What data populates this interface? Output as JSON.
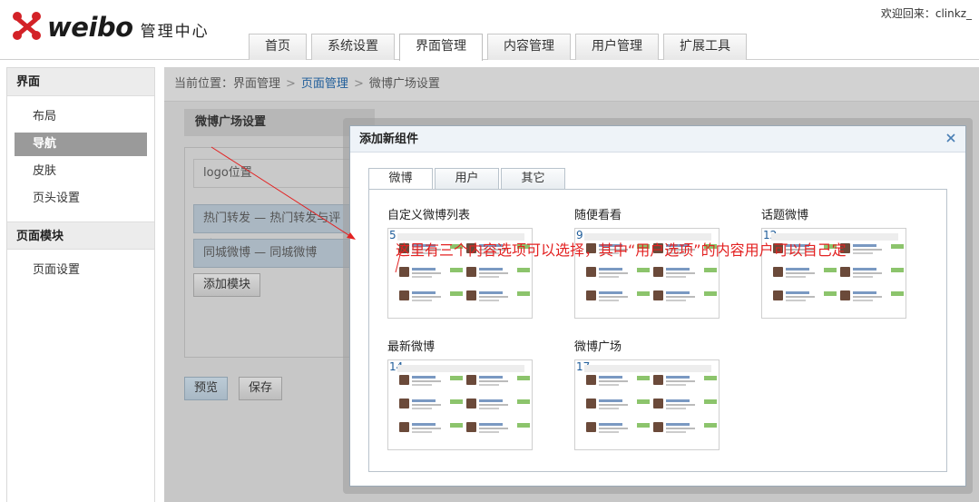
{
  "header": {
    "logo_word": "weibo",
    "logo_subtitle": "管理中心",
    "welcome": "欢迎回来：clinkz_",
    "tabs": [
      "首页",
      "系统设置",
      "界面管理",
      "内容管理",
      "用户管理",
      "扩展工具"
    ],
    "active_tab": "界面管理"
  },
  "sidebar": {
    "groups": [
      {
        "title": "界面",
        "items": [
          "布局",
          "导航",
          "皮肤",
          "页头设置"
        ]
      },
      {
        "title": "页面模块",
        "items": [
          "页面设置"
        ]
      }
    ],
    "active_item": "导航"
  },
  "breadcrumb": {
    "prefix": "当前位置：界面管理",
    "link": "页面管理",
    "current": "微博广场设置"
  },
  "panel": {
    "title": "微博广场设置",
    "logo_field": "logo位置",
    "modules": [
      "热门转发 — 热门转发与评论",
      "同城微博 — 同城微博"
    ],
    "add_button": "添加模块",
    "preview_button": "预览",
    "save_button": "保存"
  },
  "modal": {
    "title": "添加新组件",
    "tabs": [
      "微博",
      "用户",
      "其它"
    ],
    "active_tab": "微博",
    "components": [
      {
        "title": "自定义微博列表",
        "number": "5"
      },
      {
        "title": "随便看看",
        "number": "9"
      },
      {
        "title": "话题微博",
        "number": "12"
      },
      {
        "title": "最新微博",
        "number": "14"
      },
      {
        "title": "微博广场",
        "number": "17"
      }
    ]
  },
  "annotation": {
    "text": "这里有三个内容选项可以选择，其中“用户选项”的内容用户可以自己定",
    "color": "#e32222"
  },
  "colors": {
    "brand_red": "#d32227",
    "link_blue": "#1f5d9a",
    "sidebar_active": "#9a9a9a"
  }
}
